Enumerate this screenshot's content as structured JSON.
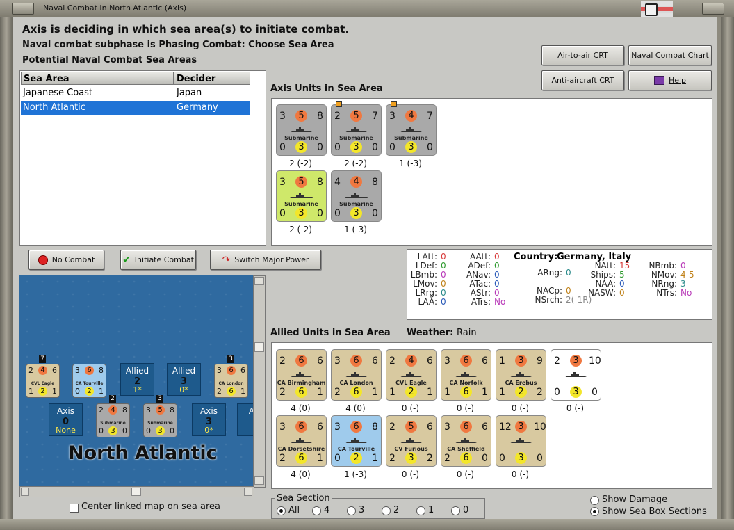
{
  "window": {
    "title": "Naval Combat In North Atlantic (Axis)"
  },
  "header": {
    "line1": "Axis is deciding in which sea area(s) to initiate combat.",
    "line2": "Naval combat subphase is Phasing Combat: Choose Sea Area",
    "line3": "Potential Naval Combat Sea Areas"
  },
  "crt_buttons": {
    "air": "Air-to-air CRT",
    "naval": "Naval Combat Chart",
    "aa": "Anti-aircraft CRT",
    "help": "Help"
  },
  "sea_table": {
    "headers": [
      "Sea Area",
      "Decider"
    ],
    "rows": [
      {
        "area": "Japanese Coast",
        "decider": "Japan"
      },
      {
        "area": "North Atlantic",
        "decider": "Germany",
        "selected": true
      }
    ]
  },
  "axis_units": {
    "label": "Axis Units in Sea Area",
    "units": [
      {
        "top": [
          "3",
          "5",
          "8"
        ],
        "name": "Submarine",
        "bottom": [
          "0",
          "3",
          "0"
        ],
        "caption": "2 (-2)",
        "bg": "#a9a9a9",
        "marker": false
      },
      {
        "top": [
          "2",
          "5",
          "7"
        ],
        "name": "Submarine",
        "bottom": [
          "0",
          "3",
          "0"
        ],
        "caption": "2 (-2)",
        "bg": "#a9a9a9",
        "marker": true
      },
      {
        "top": [
          "3",
          "4",
          "7"
        ],
        "name": "Submarine",
        "bottom": [
          "0",
          "3",
          "0"
        ],
        "caption": "1 (-3)",
        "bg": "#a9a9a9",
        "marker": true
      },
      {
        "top": [
          "3",
          "5",
          "8"
        ],
        "name": "Submarine",
        "bottom": [
          "0",
          "3",
          "0"
        ],
        "caption": "2 (-2)",
        "bg": "#cfe86a",
        "marker": false
      },
      {
        "top": [
          "4",
          "4",
          "8"
        ],
        "name": "Submarine",
        "bottom": [
          "0",
          "3",
          "0"
        ],
        "caption": "1 (-3)",
        "bg": "#a9a9a9",
        "marker": false
      }
    ]
  },
  "action_buttons": {
    "no_combat": "No Combat",
    "initiate": "Initiate Combat",
    "switch": "Switch Major Power"
  },
  "stats": {
    "country_label": "Country:",
    "country_value": "Germany, Italy",
    "col1": [
      {
        "k": "LAtt:",
        "v": "0",
        "c": "#d83a3a"
      },
      {
        "k": "LDef:",
        "v": "0",
        "c": "#2e9a2e"
      },
      {
        "k": "LBmb:",
        "v": "0",
        "c": "#b83ab8"
      },
      {
        "k": "LMov:",
        "v": "0",
        "c": "#c0821a"
      },
      {
        "k": "LRrg:",
        "v": "0",
        "c": "#2a8a8a"
      },
      {
        "k": "LAA:",
        "v": "0",
        "c": "#2a5ab8"
      }
    ],
    "col2": [
      {
        "k": "AAtt:",
        "v": "0",
        "c": "#d83a3a"
      },
      {
        "k": "ADef:",
        "v": "0",
        "c": "#2e9a2e"
      },
      {
        "k": "ANav:",
        "v": "0",
        "c": "#2a5ab8"
      },
      {
        "k": "ATac:",
        "v": "0",
        "c": "#2a5ab8"
      },
      {
        "k": "AStr:",
        "v": "0",
        "c": "#b83ab8"
      },
      {
        "k": "ATrs:",
        "v": "No",
        "c": "#b83ab8"
      }
    ],
    "col3": [
      {
        "k": "ARng:",
        "v": "0",
        "c": "#2a8a8a"
      },
      {
        "k": "NACp:",
        "v": "0",
        "c": "#c0821a"
      },
      {
        "k": "NSrch:",
        "v": "2(-1R)",
        "c": "#888888"
      }
    ],
    "col4": [
      {
        "k": "NAtt:",
        "v": "15",
        "c": "#d83a3a"
      },
      {
        "k": "Ships:",
        "v": "5",
        "c": "#2e9a2e"
      },
      {
        "k": "NAA:",
        "v": "0",
        "c": "#2a5ab8"
      },
      {
        "k": "NASW:",
        "v": "0",
        "c": "#c0821a"
      }
    ],
    "col5": [
      {
        "k": "NBmb:",
        "v": "0",
        "c": "#b83ab8"
      },
      {
        "k": "NMov:",
        "v": "4-5",
        "c": "#c0821a"
      },
      {
        "k": "NRng:",
        "v": "3",
        "c": "#2a8a8a"
      },
      {
        "k": "NTrs:",
        "v": "No",
        "c": "#b83ab8"
      }
    ]
  },
  "allied_units": {
    "label": "Allied Units in Sea Area",
    "weather_label": "Weather:",
    "weather": "Rain",
    "units": [
      {
        "top": [
          "2",
          "6",
          "6"
        ],
        "name": "CA Birmingham",
        "bottom": [
          "2",
          "6",
          "1"
        ],
        "caption": "4 (0)",
        "bg": "#d8c9a0"
      },
      {
        "top": [
          "3",
          "6",
          "6"
        ],
        "name": "CA London",
        "bottom": [
          "2",
          "6",
          "1"
        ],
        "caption": "4 (0)",
        "bg": "#d8c9a0"
      },
      {
        "top": [
          "2",
          "4",
          "6"
        ],
        "name": "CVL Eagle",
        "bottom": [
          "1",
          "2",
          "1"
        ],
        "caption": "0 (-)",
        "bg": "#d8c9a0"
      },
      {
        "top": [
          "3",
          "6",
          "6"
        ],
        "name": "CA Norfolk",
        "bottom": [
          "1",
          "6",
          "1"
        ],
        "caption": "0 (-)",
        "bg": "#d8c9a0"
      },
      {
        "top": [
          "1",
          "3",
          "9"
        ],
        "name": "CA Erebus",
        "bottom": [
          "1",
          "2",
          "2"
        ],
        "caption": "0 (-)",
        "bg": "#d8c9a0"
      },
      {
        "top": [
          "2",
          "3",
          "10"
        ],
        "name": "",
        "bottom": [
          "0",
          "3",
          "0"
        ],
        "caption": "0 (-)",
        "bg": "#ffffff"
      },
      {
        "top": [
          "3",
          "6",
          "6"
        ],
        "name": "CA Dorsetshire",
        "bottom": [
          "2",
          "6",
          "1"
        ],
        "caption": "4 (0)",
        "bg": "#d8c9a0"
      },
      {
        "top": [
          "3",
          "6",
          "8"
        ],
        "name": "CA Tourville",
        "bottom": [
          "0",
          "2",
          "1"
        ],
        "caption": "1 (-3)",
        "bg": "#9fcbec"
      },
      {
        "top": [
          "2",
          "5",
          "6"
        ],
        "name": "CV Furious",
        "bottom": [
          "2",
          "3",
          "2"
        ],
        "caption": "0 (-)",
        "bg": "#d8c9a0"
      },
      {
        "top": [
          "3",
          "6",
          "6"
        ],
        "name": "CA Sheffield",
        "bottom": [
          "2",
          "6",
          "0"
        ],
        "caption": "0 (-)",
        "bg": "#d8c9a0"
      },
      {
        "top": [
          "12",
          "3",
          "10"
        ],
        "name": "",
        "bottom": [
          "0",
          "3",
          "0"
        ],
        "caption": "0 (-)",
        "bg": "#d8c9a0"
      }
    ]
  },
  "map": {
    "sea_name": "North Atlantic",
    "boxes": [
      {
        "t": "Allied",
        "v": "2",
        "y": "1*"
      },
      {
        "t": "Allied",
        "v": "3",
        "y": "0*"
      },
      {
        "t": "Axis",
        "v": "0",
        "y": "None"
      },
      {
        "t": "Axis",
        "v": "3",
        "y": "0*"
      },
      {
        "t": "Ax",
        "v": "",
        "y": ""
      }
    ],
    "minis": [
      {
        "top": [
          "2",
          "4",
          "6"
        ],
        "name": "CVL Eagle",
        "bottom": [
          "1",
          "2",
          "1"
        ],
        "bg": "#d8c9a0",
        "badge": "7"
      },
      {
        "top": [
          "3",
          "6",
          "8"
        ],
        "name": "CA Tourville",
        "bottom": [
          "0",
          "2",
          "1"
        ],
        "bg": "#9fcbec",
        "badge": ""
      },
      {
        "top": [
          "3",
          "6",
          "6"
        ],
        "name": "CA London",
        "bottom": [
          "2",
          "6",
          "1"
        ],
        "bg": "#d8c9a0",
        "badge": "3"
      },
      {
        "top": [
          "2",
          "4",
          "8"
        ],
        "name": "Submarine",
        "bottom": [
          "0",
          "3",
          "0"
        ],
        "bg": "#a9a9a9",
        "badge": "2"
      },
      {
        "top": [
          "3",
          "5",
          "8"
        ],
        "name": "Submarine",
        "bottom": [
          "0",
          "3",
          "0"
        ],
        "bg": "#a9a9a9",
        "badge": "3"
      }
    ]
  },
  "center_map": "Center linked map on sea area",
  "sea_section": {
    "label": "Sea Section",
    "options": [
      "All",
      "4",
      "3",
      "2",
      "1",
      "0"
    ],
    "selected": "All"
  },
  "show_damage": "Show Damage",
  "show_sections": "Show Sea Box Sections"
}
